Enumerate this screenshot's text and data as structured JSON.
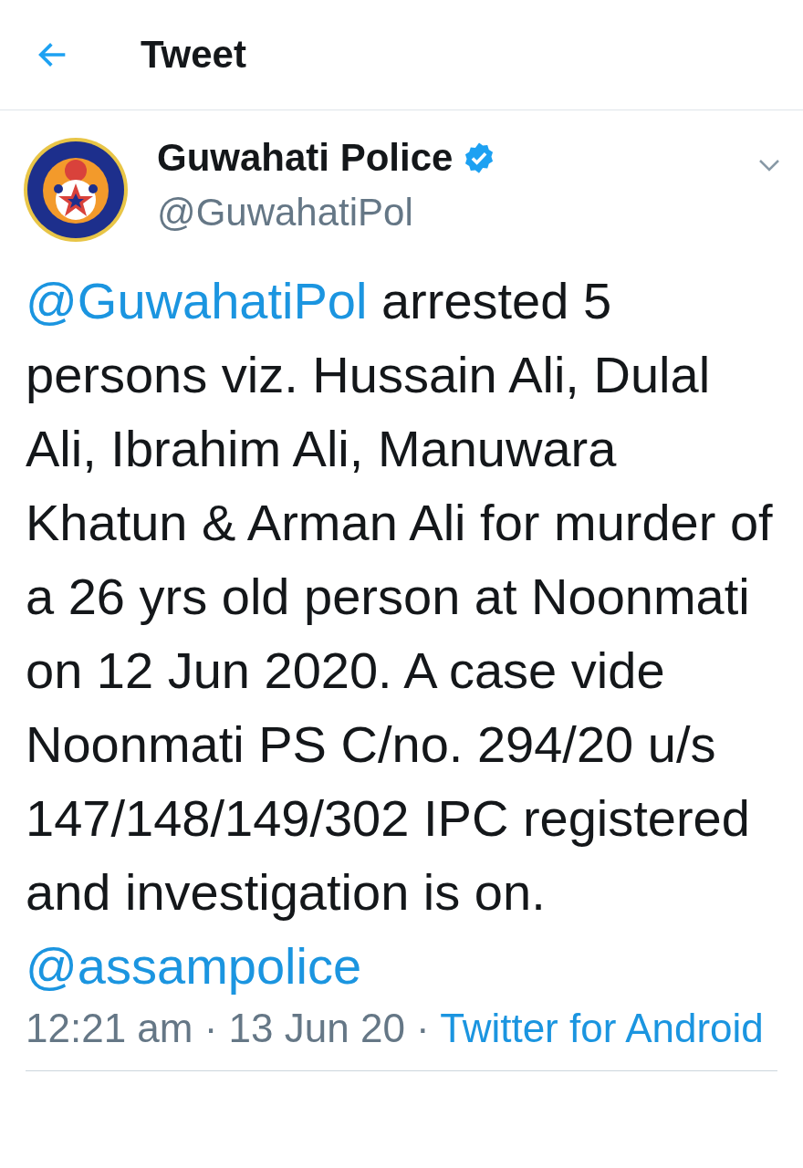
{
  "header": {
    "title": "Tweet"
  },
  "tweet": {
    "author": {
      "name": "Guwahati Police",
      "verified": true,
      "handle": "@GuwahatiPol"
    },
    "body": [
      {
        "kind": "mention",
        "text": "@GuwahatiPol"
      },
      {
        "kind": "text",
        "text": " arrested 5 persons viz. Hussain Ali, Dulal Ali, Ibrahim Ali, Manuwara Khatun & Arman Ali for murder of a 26 yrs old person at Noonmati on 12 Jun 2020. A case vide Noonmati PS C/no. 294/20 u/s 147/148/149/302 IPC registered and investigation is on. "
      },
      {
        "kind": "mention",
        "text": "@assampolice"
      }
    ],
    "meta": {
      "time": "12:21 am",
      "separator": "·",
      "date": "13 Jun 20",
      "source": "Twitter for Android"
    }
  }
}
